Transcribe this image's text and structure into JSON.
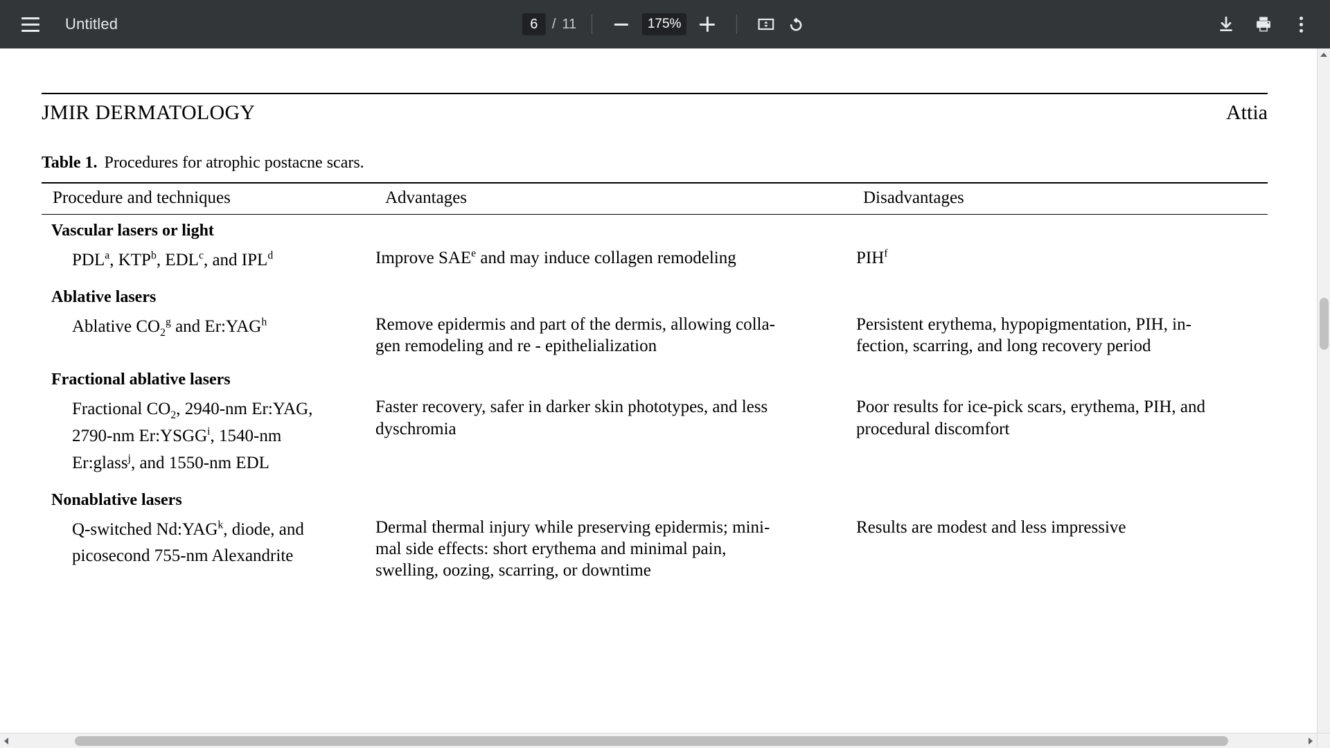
{
  "toolbar": {
    "menu_icon": "hamburger-menu-icon",
    "title": "Untitled",
    "page_current": "6",
    "page_separator": "/",
    "page_total": "11",
    "zoom_out_icon": "minus-icon",
    "zoom_level": "175%",
    "zoom_in_icon": "plus-icon",
    "fit_icon": "fit-to-page-icon",
    "rotate_icon": "rotate-counterclockwise-icon",
    "download_icon": "download-icon",
    "print_icon": "print-icon",
    "more_icon": "more-options-kebab-icon"
  },
  "document": {
    "running_head": {
      "journal": "JMIR DERMATOLOGY",
      "author": "Attia"
    },
    "caption": {
      "label": "Table 1.",
      "text": "Procedures for atrophic postacne scars."
    },
    "table": {
      "headers": [
        "Procedure and techniques",
        "Advantages",
        "Disadvantages"
      ],
      "rows": [
        {
          "type": "group",
          "group": "Vascular lasers or light"
        },
        {
          "type": "data",
          "procedure_html": "PDL<sup>a</sup>, KTP<sup>b</sup>, EDL<sup>c</sup>, and IPL<sup>d</sup>",
          "procedure_text": "PDLa, KTPb, EDLc, and IPLd",
          "advantages_html": "Improve SAE<sup>e</sup> and may induce collagen remodeling",
          "advantages_text": "Improve SAEe and may induce collagen remodeling",
          "disadvantages_html": "PIH<sup>f</sup>",
          "disadvantages_text": "PIHf"
        },
        {
          "type": "group",
          "group": "Ablative lasers"
        },
        {
          "type": "data",
          "procedure_html": "Ablative CO<sub>2</sub><sup>g</sup> and Er:YAG<sup>h</sup>",
          "procedure_text": "Ablative CO2g and Er:YAGh",
          "advantages_html": "Remove epidermis and part of the dermis, allowing colla-<br>gen remodeling and re - epithelialization",
          "advantages_text": "Remove epidermis and part of the dermis, allowing collagen remodeling and re - epithelialization",
          "disadvantages_html": "Persistent erythema, hypopigmentation, PIH, in-<br>fection, scarring, and long recovery period",
          "disadvantages_text": "Persistent erythema, hypopigmentation, PIH, infection, scarring, and long recovery period"
        },
        {
          "type": "group",
          "group": "Fractional ablative lasers"
        },
        {
          "type": "data",
          "procedure_html": "Fractional CO<sub>2</sub>, 2940-nm Er:YAG,<br>2790-nm Er:YSGG<sup>i</sup>, 1540-nm<br>Er:glass<sup>j</sup>, and 1550-nm EDL",
          "procedure_text": "Fractional CO2, 2940-nm Er:YAG, 2790-nm Er:YSGGi, 1540-nm Er:glassj, and 1550-nm EDL",
          "advantages_html": "Faster recovery, safer in darker skin phototypes, and less<br>dyschromia",
          "advantages_text": "Faster recovery, safer in darker skin phototypes, and less dyschromia",
          "disadvantages_html": "Poor results for ice-pick scars, erythema, PIH, and<br>procedural discomfort",
          "disadvantages_text": "Poor results for ice-pick scars, erythema, PIH, and procedural discomfort"
        },
        {
          "type": "group",
          "group": "Nonablative lasers"
        },
        {
          "type": "data",
          "procedure_html": "Q-switched Nd:YAG<sup>k</sup>, diode, and<br>picosecond 755-nm Alexandrite",
          "procedure_text": "Q-switched Nd:YAGk, diode, and picosecond 755-nm Alexandrite",
          "advantages_html": "Dermal thermal injury while preserving epidermis; mini-<br>mal side effects: short erythema and minimal pain,<br>swelling, oozing, scarring, or downtime",
          "advantages_text": "Dermal thermal injury while preserving epidermis; minimal side effects: short erythema and minimal pain, swelling, oozing, scarring, or downtime",
          "disadvantages_html": "Results are modest and less impressive",
          "disadvantages_text": "Results are modest and less impressive"
        }
      ]
    }
  },
  "scrollbars": {
    "vertical_up_icon": "scroll-up-arrow-icon",
    "vertical_down_icon": "scroll-down-arrow-icon",
    "horizontal_left_icon": "scroll-left-arrow-icon",
    "horizontal_right_icon": "scroll-right-arrow-icon"
  },
  "colors": {
    "toolbar_bg": "#323639",
    "toolbar_field_bg": "#202124",
    "toolbar_text": "#e8eaed",
    "page_bg": "#ffffff",
    "page_text": "#000000",
    "scrollbar_track": "#f1f1f1",
    "scrollbar_thumb": "#c1c1c1"
  }
}
